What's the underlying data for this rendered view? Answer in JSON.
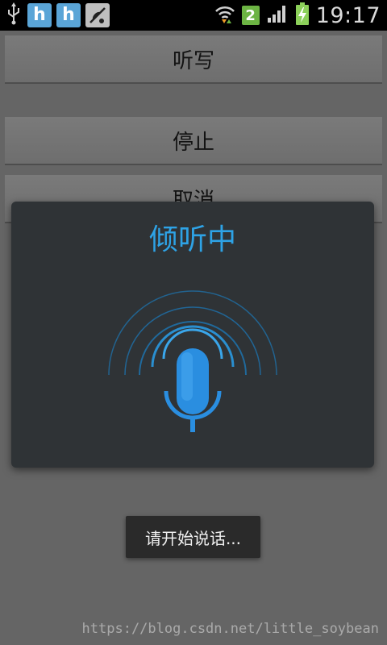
{
  "status_bar": {
    "time": "19:17",
    "sim_badge": "2",
    "icons": [
      "usb-icon",
      "app-notification-icon",
      "app-notification-icon",
      "satellite-icon",
      "wifi-icon",
      "sim-icon",
      "signal-icon",
      "battery-charging-icon"
    ]
  },
  "buttons": {
    "dictate": "听写",
    "stop": "停止",
    "cancel": "取消"
  },
  "dialog": {
    "title": "倾听中",
    "icon": "microphone-icon"
  },
  "toast": {
    "text": "请开始说话..."
  },
  "watermark": "https://blog.csdn.net/little_soybean",
  "colors": {
    "accent": "#2ea3e6",
    "background": "#656565",
    "dialog": "#2f3336"
  }
}
